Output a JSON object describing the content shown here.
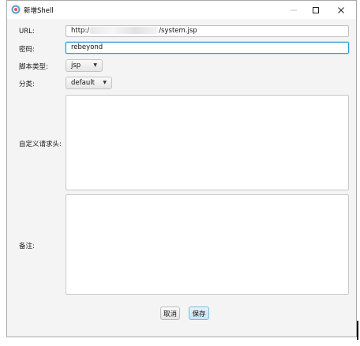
{
  "window": {
    "title": "新增Shell"
  },
  "titlebar": {
    "minimize": "—",
    "maximize": "☐",
    "close": "✕"
  },
  "form": {
    "url_label": "URL:",
    "url_prefix": "http:/",
    "url_suffix": "/system.jsp",
    "password_label": "密码:",
    "password_value": "rebeyond",
    "script_type_label": "脚本类型:",
    "script_type_value": "jsp",
    "category_label": "分类:",
    "category_value": "default",
    "headers_label": "自定义请求头:",
    "notes_label": "备注:"
  },
  "buttons": {
    "cancel": "取消",
    "save": "保存"
  },
  "icons": {
    "combo_arrow": "▼"
  },
  "colors": {
    "focus_border": "#2e9fd8",
    "save_bg": "#c9e5f5"
  }
}
